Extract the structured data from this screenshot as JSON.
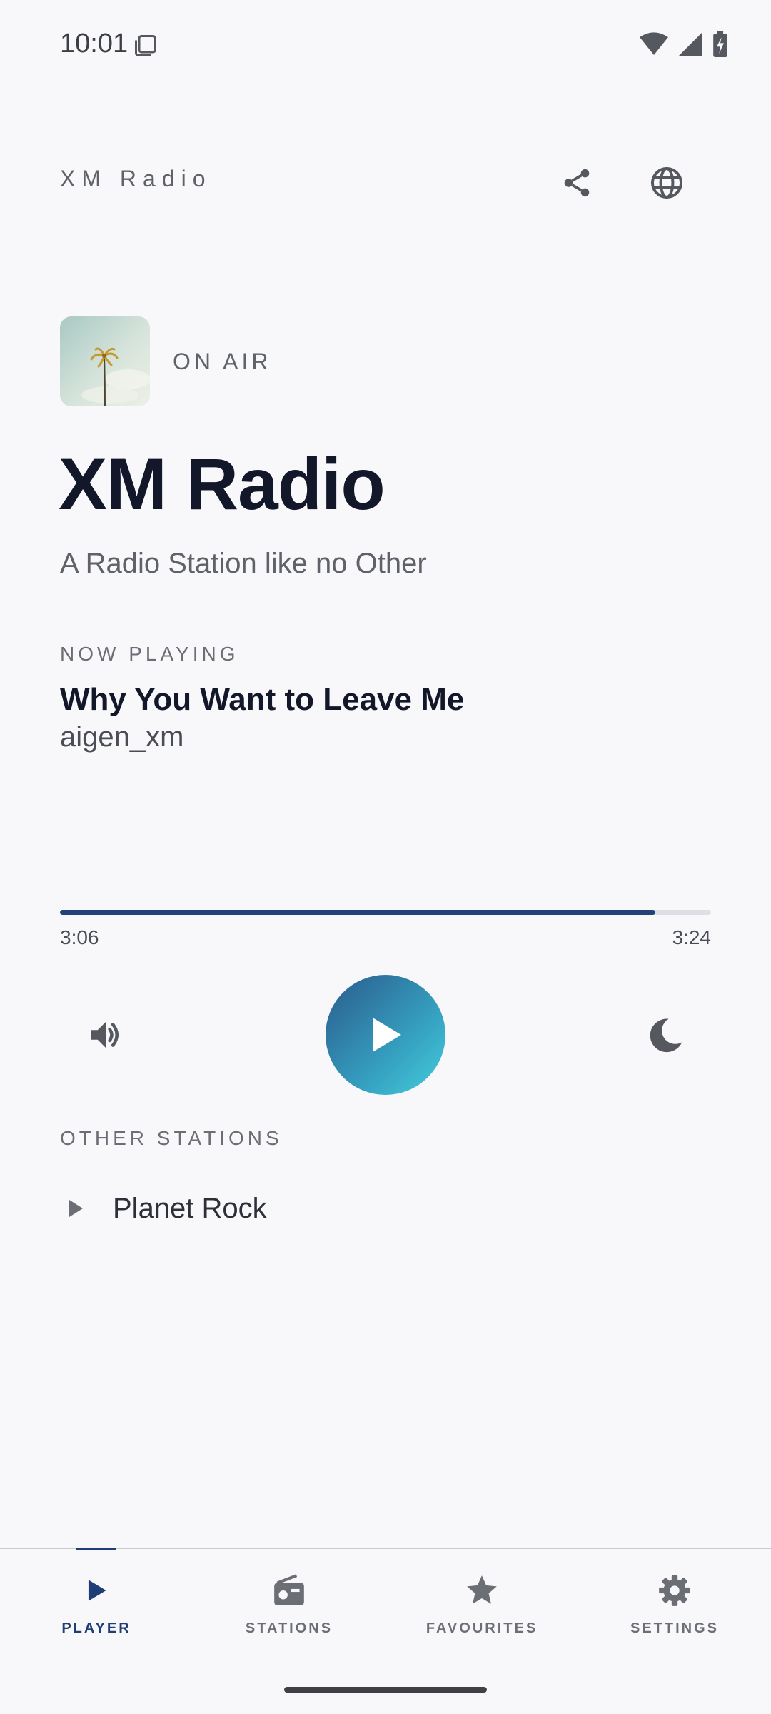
{
  "status_bar": {
    "time": "10:01"
  },
  "header": {
    "title": "XM Radio"
  },
  "station": {
    "status": "ON AIR",
    "title": "XM Radio",
    "tagline": "A Radio Station like no Other"
  },
  "now_playing": {
    "label": "NOW PLAYING",
    "track": "Why You Want to Leave Me",
    "artist": "aigen_xm",
    "elapsed": "3:06",
    "total": "3:24",
    "progress_fraction": 0.915
  },
  "other_stations": {
    "label": "OTHER STATIONS",
    "items": [
      {
        "name": "Planet Rock"
      }
    ]
  },
  "nav": {
    "items": [
      {
        "label": "PLAYER",
        "icon": "play-icon",
        "active": true
      },
      {
        "label": "STATIONS",
        "icon": "radio-icon",
        "active": false
      },
      {
        "label": "FAVOURITES",
        "icon": "star-icon",
        "active": false
      },
      {
        "label": "SETTINGS",
        "icon": "gear-icon",
        "active": false
      }
    ]
  },
  "colors": {
    "accent": "#1f3e78",
    "play_gradient_start": "#2a5a8c",
    "play_gradient_end": "#46cfdc",
    "background": "#f8f8fb"
  }
}
